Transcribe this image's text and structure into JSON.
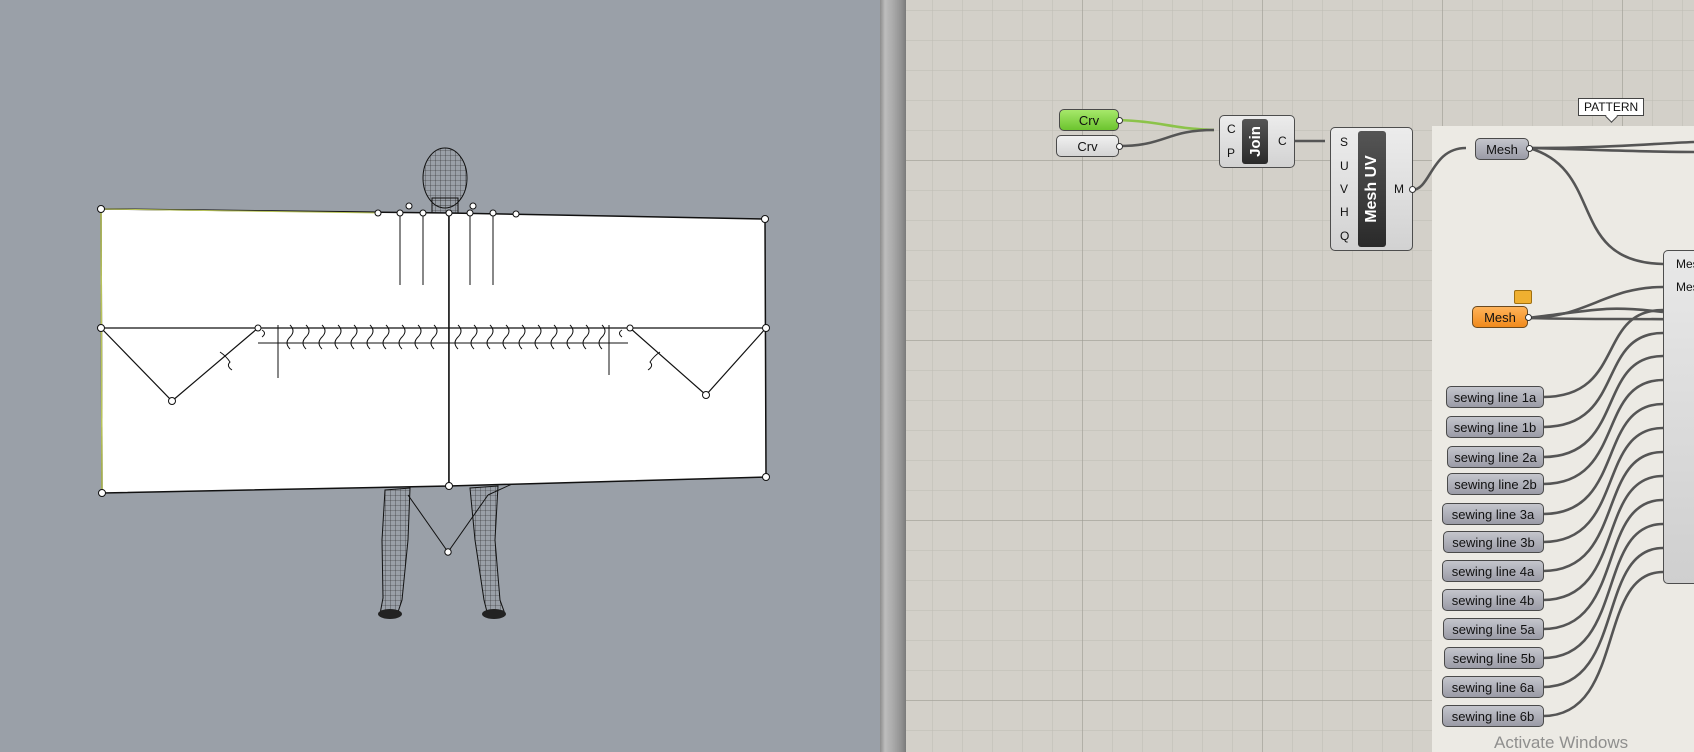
{
  "viewport": {
    "label": "Rhino 3D viewport"
  },
  "canvas": {
    "group_label": "PATTERN",
    "params": {
      "crv_1": "Crv",
      "crv_2": "Crv",
      "mesh_1": "Mesh",
      "mesh_2": "Mesh"
    },
    "join": {
      "name": "Join",
      "inputs": [
        "C",
        "P"
      ],
      "outputs": [
        "C"
      ]
    },
    "mesh_uv": {
      "name": "Mesh UV",
      "inputs": [
        "S",
        "U",
        "V",
        "H",
        "Q"
      ],
      "outputs": [
        "M"
      ]
    },
    "merge_inputs": [
      "Mes",
      "Mes"
    ],
    "sewing_lines": [
      "sewing line 1a",
      "sewing line 1b",
      "sewing line 2a",
      "sewing line 2b",
      "sewing line 3a",
      "sewing line 3b",
      "sewing line 4a",
      "sewing line 4b",
      "sewing line 5a",
      "sewing line 5b",
      "sewing line 6a",
      "sewing line 6b"
    ],
    "watermark": "Activate Windows"
  },
  "colors": {
    "viewport_bg": "#9aa0a8",
    "canvas_bg": "#d3d0c9",
    "param_green": "#7fd23c",
    "param_orange": "#f59a2a",
    "wire": "#555555",
    "wire_selected": "#8cc34a"
  }
}
